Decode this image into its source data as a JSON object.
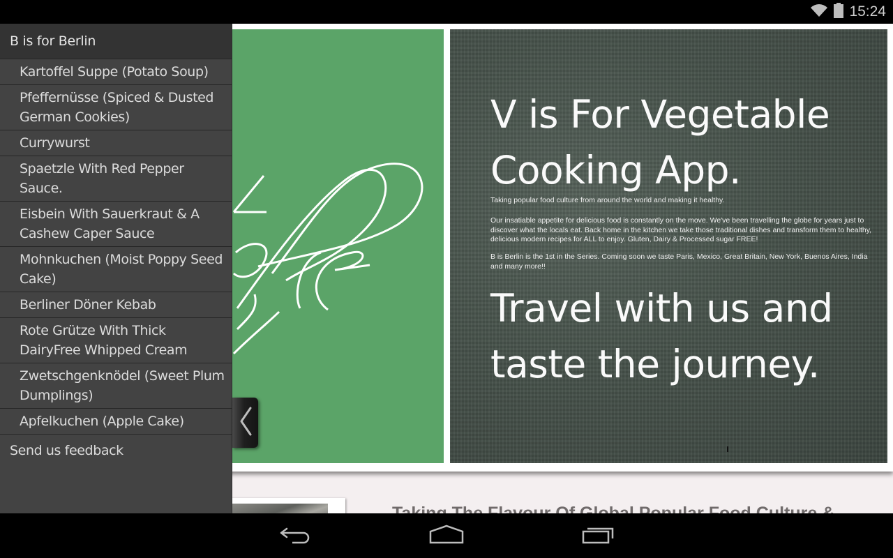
{
  "status_bar": {
    "time": "15:24",
    "icons": [
      "wifi-icon",
      "battery-icon"
    ]
  },
  "drawer": {
    "title": "B is for Berlin",
    "items": [
      {
        "label": "Kartoffel Suppe (Potato Soup)"
      },
      {
        "label": "Pfeffernüsse (Spiced & Dusted German Cookies)"
      },
      {
        "label": "Currywurst"
      },
      {
        "label": "Spaetzle With Red Pepper Sauce."
      },
      {
        "label": "Eisbein With Sauerkraut & A Cashew Caper Sauce"
      },
      {
        "label": "Mohnkuchen (Moist Poppy Seed Cake)"
      },
      {
        "label": "Berliner Döner Kebab"
      },
      {
        "label": "Rote Grütze With Thick DairyFree Whipped Cream"
      },
      {
        "label": "Zwetschgenknödel (Sweet Plum Dumplings)"
      },
      {
        "label": "Apfelkuchen (Apple Cake)"
      }
    ],
    "feedback_label": "Send us feedback",
    "handle_icon": "chevron-left-icon"
  },
  "hero": {
    "green_panel_script": "able",
    "colors": {
      "green": "#5ba468",
      "board": "#47524b"
    },
    "headline": "V is For Vegetable Cooking App.",
    "tagline": "Taking popular food culture from around the world and making it healthy.",
    "paragraph1": "Our insatiable appetite for delicious food is constantly on the move. We've been travelling the globe for years just to discover what the locals eat.  Back home in the kitchen we take those traditional dishes and transform them to healthy, delicious modern recipes for ALL to enjoy. Gluten, Dairy & Processed sugar FREE!",
    "paragraph2": "B is Berlin is the 1st in the Series.  Coming soon we taste Paris, Mexico, Great Britain, New York, Buenos Aires, India and many more!!",
    "slogan": "Travel with us and taste the journey."
  },
  "lower": {
    "heading": "Taking The Flavour Of Global Popular Food Culture &"
  },
  "nav_bar": {
    "buttons": [
      "back-icon",
      "home-icon",
      "recent-apps-icon"
    ]
  }
}
